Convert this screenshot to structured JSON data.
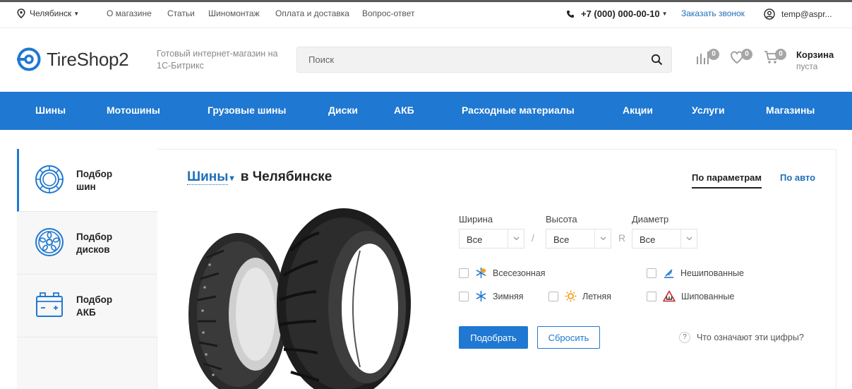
{
  "topbar": {
    "city": "Челябинск",
    "links": [
      "О магазине",
      "Статьи",
      "Шиномонтаж",
      "Оплата и доставка",
      "Вопрос-ответ"
    ],
    "phone": "+7 (000) 000-00-10",
    "callback": "Заказать звонок",
    "user": "temp@aspr..."
  },
  "header": {
    "logo": "TireShop2",
    "slogan": "Готовый интернет-магазин на 1С-Битрикс",
    "search_placeholder": "Поиск",
    "compare_count": "0",
    "favorites_count": "0",
    "cart_count": "0",
    "cart_title": "Корзина",
    "cart_status": "пуста"
  },
  "nav": [
    "Шины",
    "Мотошины",
    "Грузовые шины",
    "Диски",
    "АКБ",
    "Расходные материалы",
    "Акции",
    "Услуги",
    "Магазины"
  ],
  "sidebar": {
    "items": [
      {
        "label": "Подбор шин",
        "icon": "tire-icon"
      },
      {
        "label": "Подбор дисков",
        "icon": "wheel-rim-icon"
      },
      {
        "label": "Подбор АКБ",
        "icon": "battery-icon"
      }
    ]
  },
  "main": {
    "title_link": "Шины",
    "title_rest": "в Челябинске",
    "tabs": [
      "По параметрам",
      "По авто"
    ]
  },
  "filters": {
    "width_label": "Ширина",
    "height_label": "Высота",
    "diameter_label": "Диаметр",
    "width_value": "Все",
    "height_value": "Все",
    "diameter_value": "Все",
    "sep_slash": "/",
    "sep_r": "R",
    "season": {
      "all": "Всесезонная",
      "winter": "Зимняя",
      "summer": "Летняя"
    },
    "studs": {
      "no": "Нешипованные",
      "yes": "Шипованные"
    }
  },
  "actions": {
    "submit": "Подобрать",
    "reset": "Сбросить",
    "help": "Что означают эти цифры?"
  },
  "colors": {
    "accent": "#1f78d1",
    "badge": "#a6a6a6",
    "summer": "#f0a020",
    "studded": "#c62828"
  }
}
